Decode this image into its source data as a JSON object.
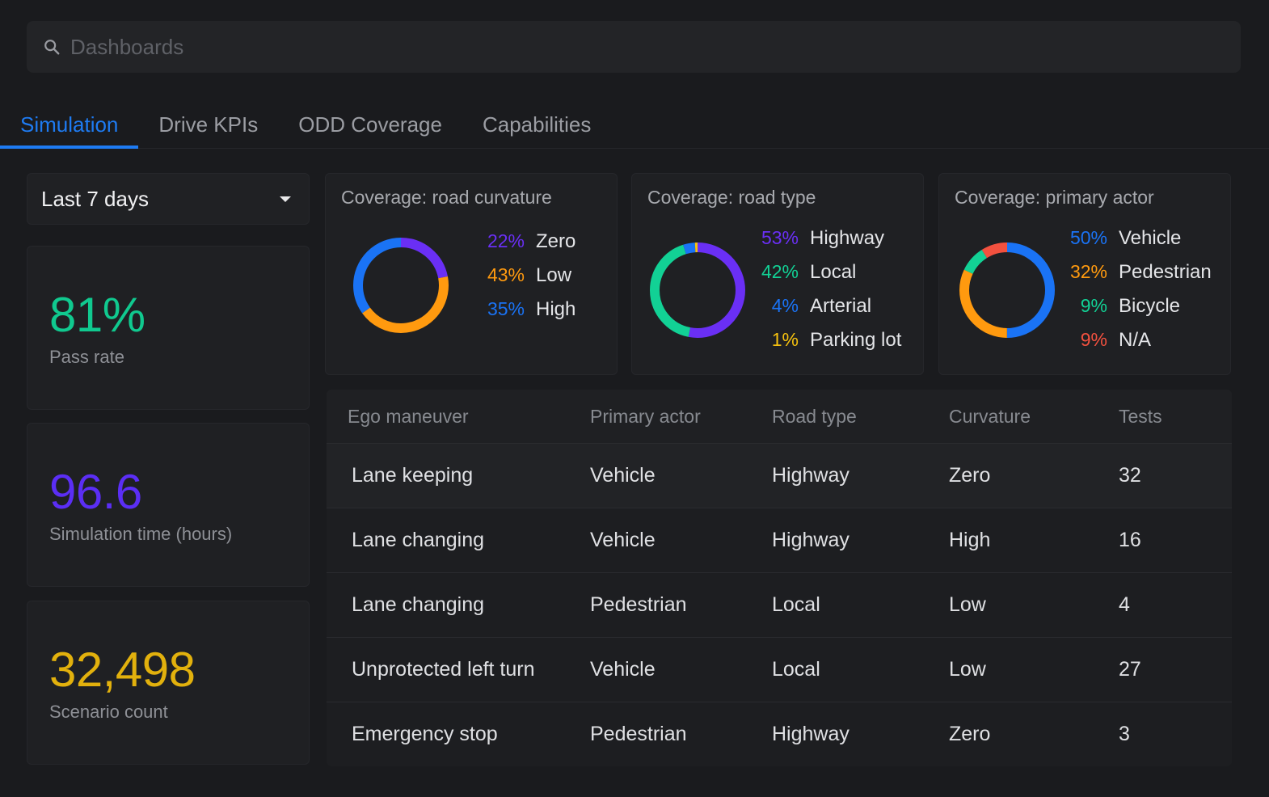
{
  "search": {
    "placeholder": "Dashboards"
  },
  "tabs": [
    {
      "label": "Simulation",
      "active": true
    },
    {
      "label": "Drive KPIs",
      "active": false
    },
    {
      "label": "ODD Coverage",
      "active": false
    },
    {
      "label": "Capabilities",
      "active": false
    }
  ],
  "range_select": {
    "value": "Last 7 days"
  },
  "stats": {
    "pass_rate": {
      "value": "81%",
      "label": "Pass rate",
      "color": "#10c98f"
    },
    "sim_time": {
      "value": "96.6",
      "label": "Simulation time (hours)",
      "color": "#5b2ef5"
    },
    "scenario_count": {
      "value": "32,498",
      "label": "Scenario count",
      "color": "#e2b10d"
    }
  },
  "coverage": {
    "curvature": {
      "title": "Coverage: road curvature",
      "items": [
        {
          "pct": "22%",
          "name": "Zero",
          "value": 22,
          "color": "#6a2ff5"
        },
        {
          "pct": "43%",
          "name": "Low",
          "value": 43,
          "color": "#ff9a0f"
        },
        {
          "pct": "35%",
          "name": "High",
          "value": 35,
          "color": "#1a73f5"
        }
      ]
    },
    "road_type": {
      "title": "Coverage: road type",
      "items": [
        {
          "pct": "53%",
          "name": "Highway",
          "value": 53,
          "color": "#6a2ff5"
        },
        {
          "pct": "42%",
          "name": "Local",
          "value": 42,
          "color": "#12d195"
        },
        {
          "pct": "4%",
          "name": "Arterial",
          "value": 4,
          "color": "#1a73f5"
        },
        {
          "pct": "1%",
          "name": "Parking lot",
          "value": 1,
          "color": "#f5c10f"
        }
      ]
    },
    "primary_actor": {
      "title": "Coverage: primary actor",
      "items": [
        {
          "pct": "50%",
          "name": "Vehicle",
          "value": 50,
          "color": "#1a73f5"
        },
        {
          "pct": "32%",
          "name": "Pedestrian",
          "value": 32,
          "color": "#ff9a0f"
        },
        {
          "pct": "9%",
          "name": "Bicycle",
          "value": 9,
          "color": "#12d195"
        },
        {
          "pct": "9%",
          "name": "N/A",
          "value": 9,
          "color": "#f2513f"
        }
      ]
    }
  },
  "table": {
    "headers": [
      "Ego maneuver",
      "Primary actor",
      "Road type",
      "Curvature",
      "Tests"
    ],
    "rows": [
      [
        "Lane keeping",
        "Vehicle",
        "Highway",
        "Zero",
        "32"
      ],
      [
        "Lane changing",
        "Vehicle",
        "Highway",
        "High",
        "16"
      ],
      [
        "Lane changing",
        "Pedestrian",
        "Local",
        "Low",
        "4"
      ],
      [
        "Unprotected left turn",
        "Vehicle",
        "Local",
        "Low",
        "27"
      ],
      [
        "Emergency stop",
        "Pedestrian",
        "Highway",
        "Zero",
        "3"
      ]
    ]
  }
}
